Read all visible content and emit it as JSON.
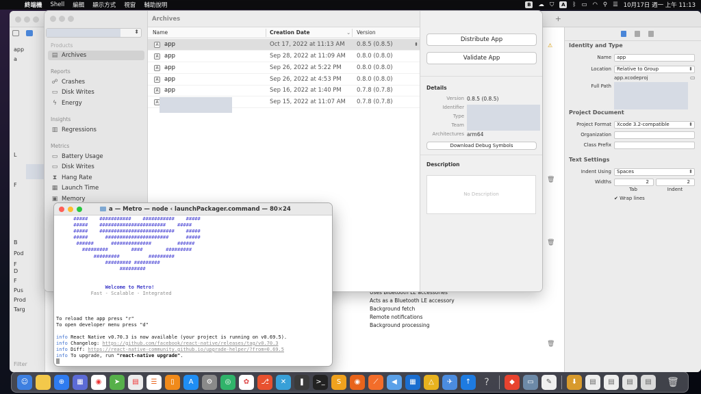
{
  "menubar": {
    "items": [
      "終端機",
      "Shell",
      "編輯",
      "顯示方式",
      "視窗",
      "輔助說明"
    ],
    "clock": "10月17日 週一 上午 11:13",
    "input_badge": "A"
  },
  "xcode": {
    "nav_rows": [
      "app",
      "a",
      "L",
      "F",
      "B",
      "Pod",
      "F",
      "D",
      "F",
      "Pus",
      "Prod",
      "Targ"
    ],
    "filter_placeholder": "Filter",
    "inspector": {
      "section_identity": "Identity and Type",
      "name_label": "Name",
      "name_value": "app",
      "location_label": "Location",
      "location_value": "Relative to Group",
      "file_value": "app.xcodeproj",
      "fullpath_label": "Full Path",
      "section_document": "Project Document",
      "format_label": "Project Format",
      "format_value": "Xcode 3.2-compatible",
      "org_label": "Organization",
      "prefix_label": "Class Prefix",
      "section_text": "Text Settings",
      "indent_label": "Indent Using",
      "indent_value": "Spaces",
      "widths_label": "Widths",
      "tab_value": "2",
      "indent_width_value": "2",
      "tab_label": "Tab",
      "indent_label2": "Indent",
      "wrap_label": "Wrap lines"
    },
    "capabilities": [
      "Uses Bluetooth LE accessories",
      "Acts as a Bluetooth LE accessory",
      "Background fetch",
      "Remote notifications",
      "Background processing"
    ]
  },
  "organizer": {
    "title": "Archives",
    "sidebar": {
      "products_header": "Products",
      "archives": "Archives",
      "reports_header": "Reports",
      "crashes": "Crashes",
      "disk_writes": "Disk Writes",
      "energy": "Energy",
      "insights_header": "Insights",
      "regressions": "Regressions",
      "metrics_header": "Metrics",
      "battery": "Battery Usage",
      "disk_writes2": "Disk Writes",
      "hang_rate": "Hang Rate",
      "launch_time": "Launch Time",
      "memory": "Memory"
    },
    "columns": {
      "name": "Name",
      "date": "Creation Date",
      "version": "Version"
    },
    "rows": [
      {
        "name": "app",
        "date": "Oct 17, 2022 at 11:13 AM",
        "version": "0.8.5 (0.8.5)"
      },
      {
        "name": "app",
        "date": "Sep 28, 2022 at 11:09 AM",
        "version": "0.8.0 (0.8.0)"
      },
      {
        "name": "app",
        "date": "Sep 26, 2022 at 5:22 PM",
        "version": "0.8.0 (0.8.0)"
      },
      {
        "name": "app",
        "date": "Sep 26, 2022 at 4:53 PM",
        "version": "0.8.0 (0.8.0)"
      },
      {
        "name": "app",
        "date": "Sep 16, 2022 at 1:40 PM",
        "version": "0.7.8 (0.7.8)"
      },
      {
        "name": "",
        "date": "Sep 15, 2022 at 11:07 AM",
        "version": "0.7.8 (0.7.8)"
      }
    ],
    "right": {
      "distribute": "Distribute App",
      "validate": "Validate App",
      "details_header": "Details",
      "version_label": "Version",
      "version_value": "0.8.5 (0.8.5)",
      "identifier_label": "Identifier",
      "type_label": "Type",
      "team_label": "Team",
      "arch_label": "Architectures",
      "arch_value": "arm64",
      "debug_symbols": "Download Debug Symbols",
      "description_header": "Description",
      "no_description": "No Description"
    }
  },
  "terminal": {
    "title": "a — Metro — node ‹ launchPackager.command — 80×24",
    "art": [
      "      #####    ###########    ###########    #####",
      "      #####    #######################    #####",
      "      #####    ##########################    #####",
      "      #####      ######################      #####",
      "       ######      ##############         ######",
      "         #########        ####        #########",
      "             #########          #########",
      "                 ######### #########",
      "                      #########"
    ],
    "welcome": "                 Welcome to Metro!",
    "tagline": "            Fast - Scalable - Integrated",
    "reload": "To reload the app press \"r\"",
    "devmenu": "To open developer menu press \"d\"",
    "info_word": "info",
    "info1": " React Native v0.70.3 is now available (your project is running on v0.69.5).",
    "info2_label": " Changelog: ",
    "info2_link": "https://github.com/facebook/react-native/releases/tag/v0.70.3",
    "info3_label": " Diff: ",
    "info3_link": "https://react-native-community.github.io/upgrade-helper/?from=0.69.5",
    "info4_pre": " To upgrade, run ",
    "info4_cmd": "\"react-native upgrade\"",
    "info4_post": "."
  }
}
